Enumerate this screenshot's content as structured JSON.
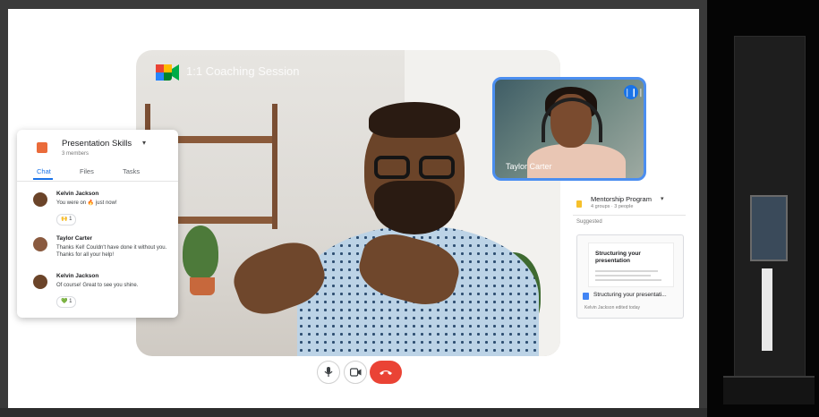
{
  "meeting": {
    "title": "1:1 Coaching Session"
  },
  "pip": {
    "name": "Taylor Carter",
    "speaking_icon": "audio-wave-icon"
  },
  "chat": {
    "space_name": "Presentation Skills",
    "members": "3 members",
    "tabs": [
      "Chat",
      "Files",
      "Tasks"
    ],
    "active_tab": "Chat",
    "messages": [
      {
        "author": "Kelvin Jackson",
        "text": "You were on 🔥 just now!",
        "reaction": "🙌 1"
      },
      {
        "author": "Taylor Carter",
        "text": "Thanks Kel! Couldn't have done it without you. Thanks for all your help!",
        "reaction": ""
      },
      {
        "author": "Kelvin Jackson",
        "text": "Of course! Great to see you shine.",
        "reaction": "💚 1"
      }
    ]
  },
  "mentorship": {
    "title": "Mentorship Program",
    "subtitle": "4 groups · 3 people",
    "section_label": "Suggested",
    "doc_preview_title": "Structuring your presentation",
    "doc_name": "Structuring your presentati...",
    "doc_meta": "Kelvin Jackson edited today"
  },
  "controls": {
    "mic_icon": "microphone-icon",
    "camera_icon": "camera-icon",
    "end_icon": "end-call-icon"
  },
  "colors": {
    "accent": "#1a73e8",
    "end_call": "#ea4335",
    "pip_border": "#4b8ef0"
  }
}
